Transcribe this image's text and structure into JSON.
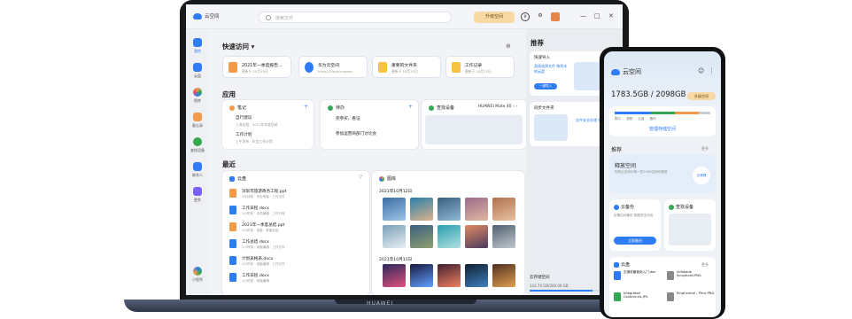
{
  "app": {
    "name": "云空间",
    "search_placeholder": "搜索文件",
    "upgrade_label": "升级空间",
    "brand": "HUAWEI"
  },
  "sidebar": {
    "items": [
      {
        "label": "我的",
        "color": "#2f7df6"
      },
      {
        "label": "云盘",
        "color": "#2f7df6"
      },
      {
        "label": "图库",
        "color": "#f2994a"
      },
      {
        "label": "备忘录",
        "color": "#f2994a"
      },
      {
        "label": "查找设备",
        "color": "#34a853"
      },
      {
        "label": "联系人",
        "color": "#2f7df6"
      },
      {
        "label": "更多",
        "color": "#7b61ff"
      }
    ],
    "bottom_label": "小程序"
  },
  "quick": {
    "title": "快速访问",
    "items": [
      {
        "title": "2021年一季度报告...",
        "sub": "更新于 10月19日",
        "color": "#f2994a"
      },
      {
        "title": "华为云空间",
        "sub": "https://cloud.huawei...",
        "color": "#2f7df6"
      },
      {
        "title": "重要的文件夹",
        "sub": "更新于 10月15日",
        "color": "#f6c343"
      },
      {
        "title": "工作记录",
        "sub": "更新于 10月12日",
        "color": "#f6c343"
      }
    ]
  },
  "apps": {
    "title": "应用",
    "notes": {
      "title": "笔记",
      "items": [
        {
          "t": "自行建议",
          "s": "上海出租 · 2021年年度总结"
        },
        {
          "t": "工作计划",
          "s": "上午发布 · 年会工作计划"
        }
      ]
    },
    "todo": {
      "title": "待办",
      "items": [
        {
          "t": "完参买、看证",
          "s": ""
        },
        {
          "t": "参加运营商部门讨论会",
          "s": ""
        }
      ]
    },
    "device": {
      "title": "查找设备",
      "model": "HUAWEI Mate 40"
    }
  },
  "recent": {
    "title": "最近",
    "drive": {
      "title": "云盘",
      "files": [
        {
          "n": "深圳市旅游政务工程.ppt",
          "m": "5分钟前 · 来自电脑 · 工作文件",
          "c": "#f2994a"
        },
        {
          "n": "工作日程.docx",
          "m": "1小时前 · 手机编辑 · 工作日程",
          "c": "#2f7df6"
        },
        {
          "n": "2021年一季度总结.ppt",
          "m": "2小时前 · 电脑 · 季度总结",
          "c": "#f2994a"
        },
        {
          "n": "工作总结.docx",
          "m": "1小时前 · 电脑编辑 · 工作文件",
          "c": "#2f7df6"
        },
        {
          "n": "计划表格表.docx",
          "m": "1小时前 · 电脑编辑 · 工作文件",
          "c": "#2f7df6"
        },
        {
          "n": "工作日程.docx",
          "m": "1小时前 · 电脑编辑",
          "c": "#2f7df6"
        }
      ]
    },
    "gallery": {
      "title": "图库",
      "date1": "2021年10月12日",
      "date2": "2021年10月11日"
    }
  },
  "recommend": {
    "title": "推荐",
    "card1_title": "快速导入",
    "card1_text": "直接选择文件 拖到本地云盘",
    "card1_btn": "一键导入",
    "card2_title": "同步文件夹",
    "card2_text": "文件安全存储 多设备同步"
  },
  "storage": {
    "title": "云存储空间",
    "usage": "143.74 GB/200.00 GB",
    "fraction": 0.72
  },
  "phone": {
    "title": "云空间",
    "usage": "1783.5GB / 2098GB",
    "upgrade": "升级空间",
    "legend": [
      "照片",
      "视频",
      "云盘",
      "备份"
    ],
    "manage": "管理存储空间",
    "rec_title": "推荐",
    "more": "更多",
    "rec_card": "释放空间",
    "rec_sub": "你的云空间中有一些100K空间可释放",
    "rec_btn": "去清理",
    "backup_title": "云备份",
    "backup_text": "定期自动备份 数据安全无忧",
    "backup_btn": "立即备份",
    "find_title": "查找设备",
    "drive_title": "云盘",
    "files": [
      {
        "n": "无锡收藏使用入门.doc",
        "c": "#2f7df6"
      },
      {
        "n": "Inflatable Sculptures.PNG",
        "c": "#888"
      },
      {
        "n": "Integrated Content.xls.JPG",
        "c": "#34a853"
      },
      {
        "n": "RingCentral - Price.PNG",
        "c": "#888"
      }
    ]
  }
}
